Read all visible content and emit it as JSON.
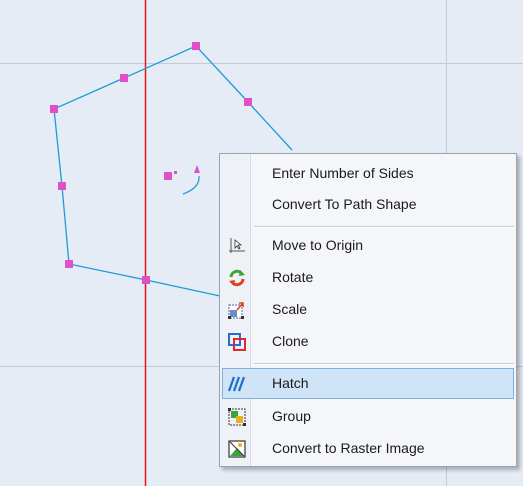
{
  "colors": {
    "canvas_bg": "#e6ecf5",
    "grid_line": "#c3cbd8",
    "axis_line": "#e8121a",
    "shape_stroke": "#1e9bd7",
    "handle": "#e050c8",
    "menu_highlight": "#cfe4f7"
  },
  "context_menu": {
    "items": [
      {
        "label": "Enter Number of Sides",
        "icon": null
      },
      {
        "label": "Convert To Path Shape",
        "icon": null
      },
      {
        "label": "Move to Origin",
        "icon": "move-to-origin-icon"
      },
      {
        "label": "Rotate",
        "icon": "rotate-icon"
      },
      {
        "label": "Scale",
        "icon": "scale-icon"
      },
      {
        "label": "Clone",
        "icon": "clone-icon"
      },
      {
        "label": "Hatch",
        "icon": "hatch-icon",
        "highlighted": true
      },
      {
        "label": "Group",
        "icon": "group-icon"
      },
      {
        "label": "Convert to Raster Image",
        "icon": "raster-image-icon"
      }
    ]
  }
}
